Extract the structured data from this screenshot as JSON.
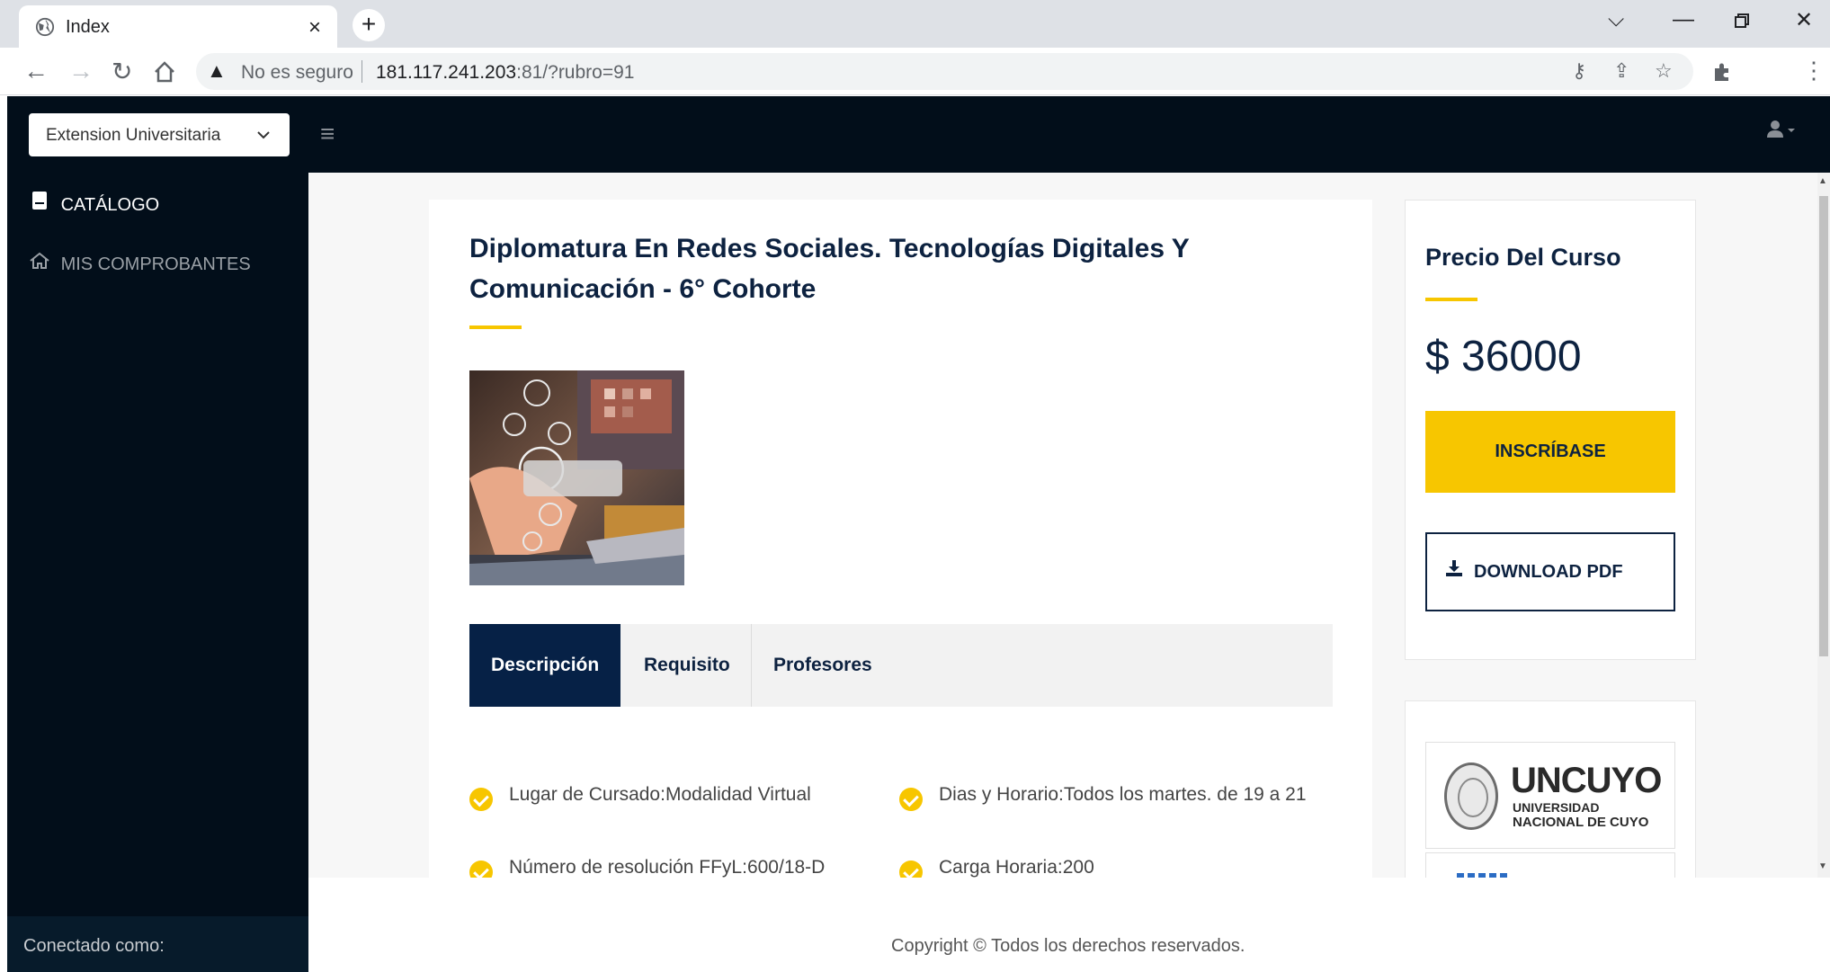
{
  "browser": {
    "tab_title": "Index",
    "tab_close": "×",
    "new_tab": "+",
    "security_label": "No es seguro",
    "url_host": "181.117.241.203",
    "url_rest": ":81/?rubro=91"
  },
  "app": {
    "rubro_selected": "Extension Universitaria",
    "sidebar": {
      "items": [
        {
          "label": "CATÁLOGO",
          "icon": "book-icon",
          "active": true
        },
        {
          "label": "MIS COMPROBANTES",
          "icon": "home-icon",
          "active": false
        }
      ],
      "footer": "Conectado como:"
    },
    "course": {
      "title": "Diplomatura En Redes Sociales. Tecnologías Digitales Y Comunicación - 6° Cohorte",
      "tabs": [
        {
          "label": "Descripción",
          "active": true
        },
        {
          "label": "Requisito",
          "active": false
        },
        {
          "label": "Profesores",
          "active": false
        }
      ],
      "details": [
        "Lugar de Cursado:Modalidad Virtual",
        "Dias y Horario:Todos los martes. de 19 a 21",
        "Número de resolución FFyL:600/18-D",
        "Carga Horaria:200"
      ]
    },
    "pricing": {
      "label": "Precio Del Curso",
      "value": "$ 36000",
      "enroll_button": "INSCRÍBASE",
      "pdf_button": "DOWNLOAD PDF"
    },
    "logos": {
      "uncuyo": "UNCUYO",
      "uncuyo_sub1": "UNIVERSIDAD",
      "uncuyo_sub2": "NACIONAL DE CUYO"
    },
    "footer": "Copyright © Todos los derechos reservados."
  },
  "colors": {
    "accent": "#f7c600",
    "navy": "#0d2240",
    "header_bg": "#020e1a"
  }
}
